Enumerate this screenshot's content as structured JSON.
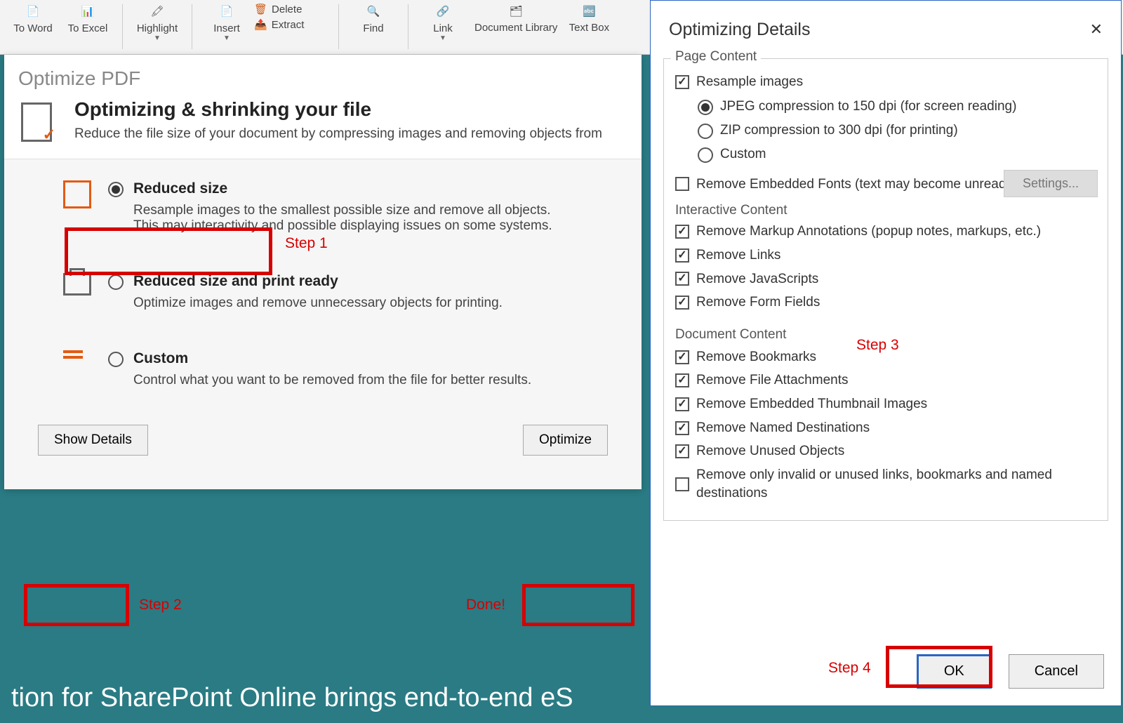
{
  "toolbar": {
    "to_word": "To Word",
    "to_excel": "To Excel",
    "highlight": "Highlight",
    "insert": "Insert",
    "delete": "Delete",
    "extract": "Extract",
    "find": "Find",
    "link": "Link",
    "doc_library": "Document Library",
    "text_box": "Text Box"
  },
  "wizard": {
    "panel_title": "Optimize PDF",
    "heading": "Optimizing & shrinking your file",
    "subhead": "Reduce the file size of your document by compressing images and removing objects from",
    "opt1_title": "Reduced size",
    "opt1_desc": "Resample images to the smallest possible size and remove all objects. This may interactivity and possible displaying issues on some systems.",
    "opt2_title": "Reduced size and print ready",
    "opt2_desc": "Optimize images and remove unnecessary objects for printing.",
    "opt3_title": "Custom",
    "opt3_desc": "Control what you want to be removed from the file for better results.",
    "show_details": "Show Details",
    "optimize": "Optimize"
  },
  "annotations": {
    "step1": "Step 1",
    "step2": "Step 2",
    "done": "Done!",
    "step3": "Step 3",
    "step4": "Step 4"
  },
  "dialog": {
    "title": "Optimizing Details",
    "page_content": "Page Content",
    "resample": "Resample images",
    "jpeg150": "JPEG compression to 150 dpi (for screen reading)",
    "zip300": "ZIP compression to 300 dpi (for printing)",
    "custom_comp": "Custom",
    "settings": "Settings...",
    "remove_fonts": "Remove Embedded Fonts (text may become unreadable)",
    "interactive_content": "Interactive Content",
    "remove_markup": "Remove Markup Annotations (popup notes, markups, etc.)",
    "remove_links": "Remove Links",
    "remove_js": "Remove JavaScripts",
    "remove_form": "Remove Form Fields",
    "document_content": "Document Content",
    "remove_bookmarks": "Remove Bookmarks",
    "remove_attachments": "Remove File Attachments",
    "remove_thumbs": "Remove Embedded Thumbnail Images",
    "remove_named": "Remove Named Destinations",
    "remove_unused": "Remove Unused Objects",
    "remove_invalid": "Remove only invalid or unused links, bookmarks and named destinations",
    "ok": "OK",
    "cancel": "Cancel"
  },
  "bg_text": "tion for SharePoint Online brings end-to-end eS"
}
